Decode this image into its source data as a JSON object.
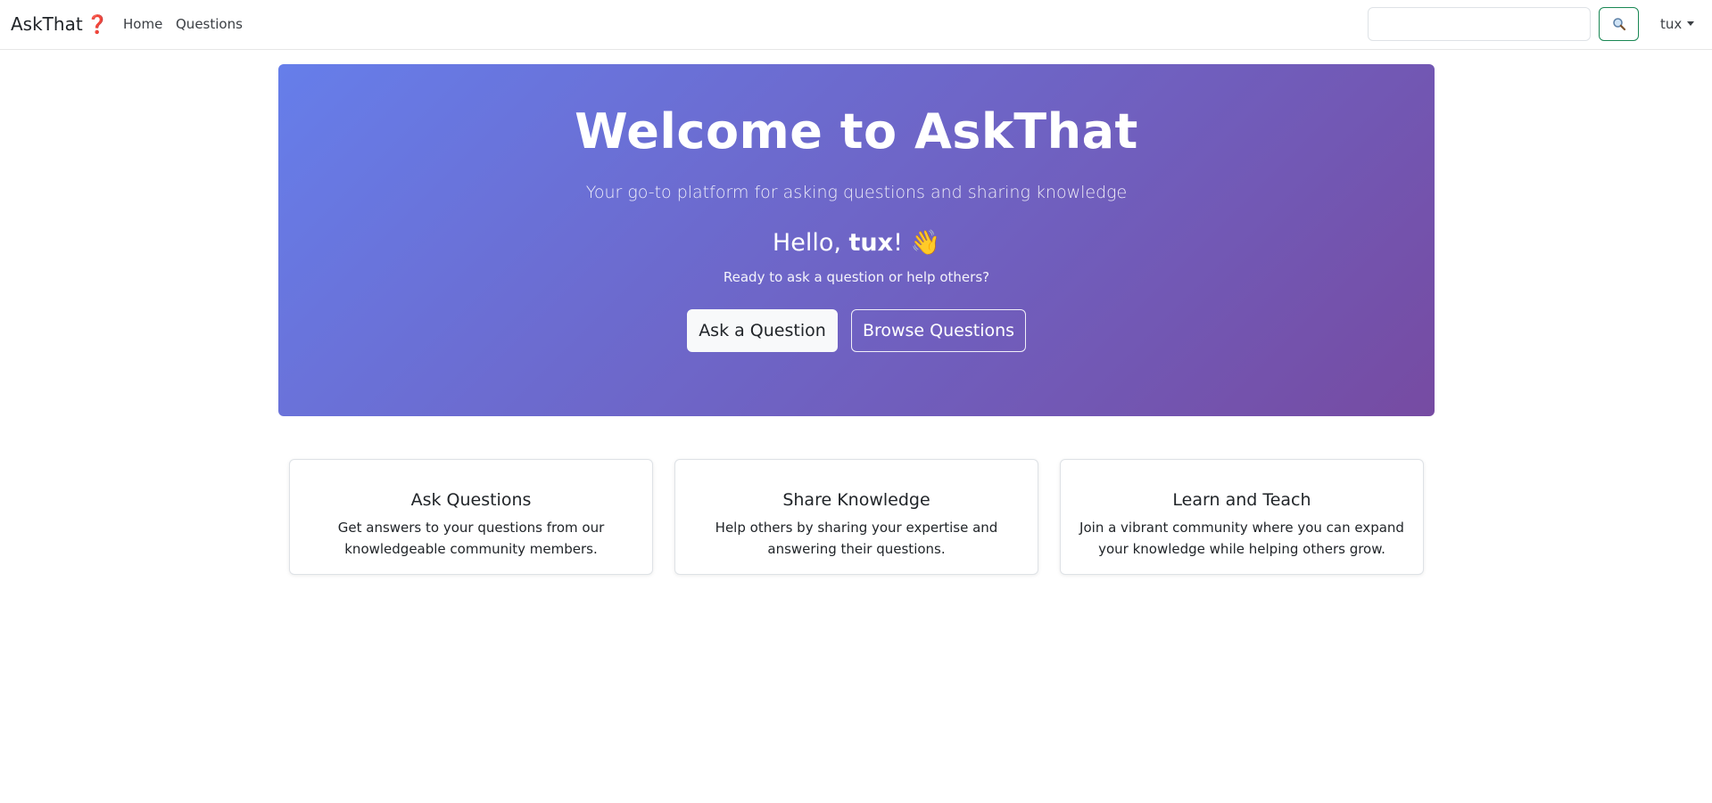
{
  "navbar": {
    "brand": "AskThat",
    "brand_emoji": "❓",
    "links": [
      {
        "label": "Home"
      },
      {
        "label": "Questions"
      }
    ],
    "search": {
      "placeholder": "",
      "value": "",
      "button_icon": "search-icon"
    },
    "user": {
      "label": "tux",
      "icon": "caret-down-icon"
    }
  },
  "hero": {
    "title": "Welcome to AskThat",
    "subtitle": "Your go-to platform for asking questions and sharing knowledge",
    "greeting_prefix": "Hello, ",
    "greeting_name": "tux",
    "greeting_suffix": "! 👋",
    "prompt": "Ready to ask a question or help others?",
    "primary_button": "Ask a Question",
    "secondary_button": "Browse Questions",
    "gradient": [
      "#667eea",
      "#764ba2"
    ]
  },
  "features": [
    {
      "title": "Ask Questions",
      "text": "Get answers to your questions from our knowledgeable community members."
    },
    {
      "title": "Share Knowledge",
      "text": "Help others by sharing your expertise and answering their questions."
    },
    {
      "title": "Learn and Teach",
      "text": "Join a vibrant community where you can expand your knowledge while helping others grow."
    }
  ],
  "colors": {
    "search_button_border": "#198754",
    "brand_emoji": "#d9232d"
  }
}
